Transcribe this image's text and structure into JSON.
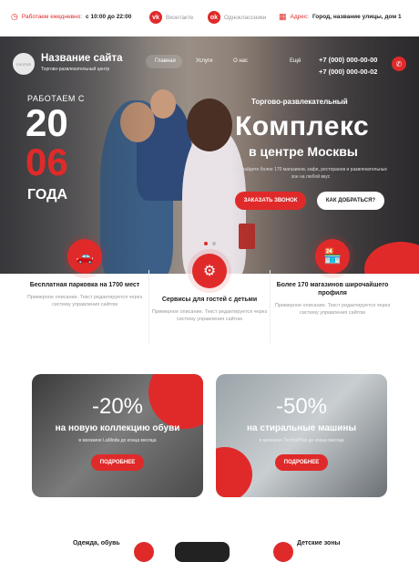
{
  "topbar": {
    "hours_label": "Работаем ежедневно:",
    "hours_value": "с 10:00 до 22:00",
    "vk": "Вконтакте",
    "ok": "Одноклассники",
    "address_label": "Адрес:",
    "address_value": "Город, название улицы, дом 1"
  },
  "header": {
    "logo_text": "логотип",
    "site_name": "Название сайта",
    "site_sub": "Торгово-развлекательный центр",
    "nav": [
      "Главная",
      "Услуги",
      "О нас",
      "Ещё"
    ],
    "phones": [
      "+7 (000) 000-00-00",
      "+7 (000) 000-00-02"
    ]
  },
  "hero": {
    "since": "РАБОТАЕМ С",
    "year_top": "20",
    "year_bottom": "06",
    "years": "ГОДА",
    "subtitle": "Торгово-развлекательный",
    "title": "Комплекс",
    "title2": "в центре Москвы",
    "desc": "Вы найдете более 170 магазинов, кафе, ресторанов и развлекательных зон на любой вкус",
    "btn_call": "ЗАКАЗАТЬ ЗВОНОК",
    "btn_route": "КАК ДОБРАТЬСЯ?"
  },
  "features": [
    {
      "title": "Бесплатная парковка на 1700 мест",
      "desc": "Примерное описание. Текст редактируется через систему управления сайтом",
      "icon": "car-icon"
    },
    {
      "title": "Сервисы для гостей с детьми",
      "desc": "Примерное описание. Текст редактируется через систему управления сайтом",
      "icon": "stroller-icon"
    },
    {
      "title": "Более 170 магазинов широчайшего профиля",
      "desc": "Примерное описание. Текст редактируется через систему управления сайтом",
      "icon": "shop-icon"
    }
  ],
  "promos": [
    {
      "pct": "-20%",
      "line": "на новую коллекцию обуви",
      "small": "в магазине LaModa до конца месяца",
      "btn": "ПОДРОБНЕЕ"
    },
    {
      "pct": "-50%",
      "line": "на стиральные машины",
      "small": "в магазине TechnoPlus до конца месяца",
      "btn": "ПОДРОБНЕЕ"
    }
  ],
  "bottom": {
    "left": "Одежда, обувь",
    "right": "Детские зоны"
  },
  "colors": {
    "accent": "#e02a2a"
  }
}
